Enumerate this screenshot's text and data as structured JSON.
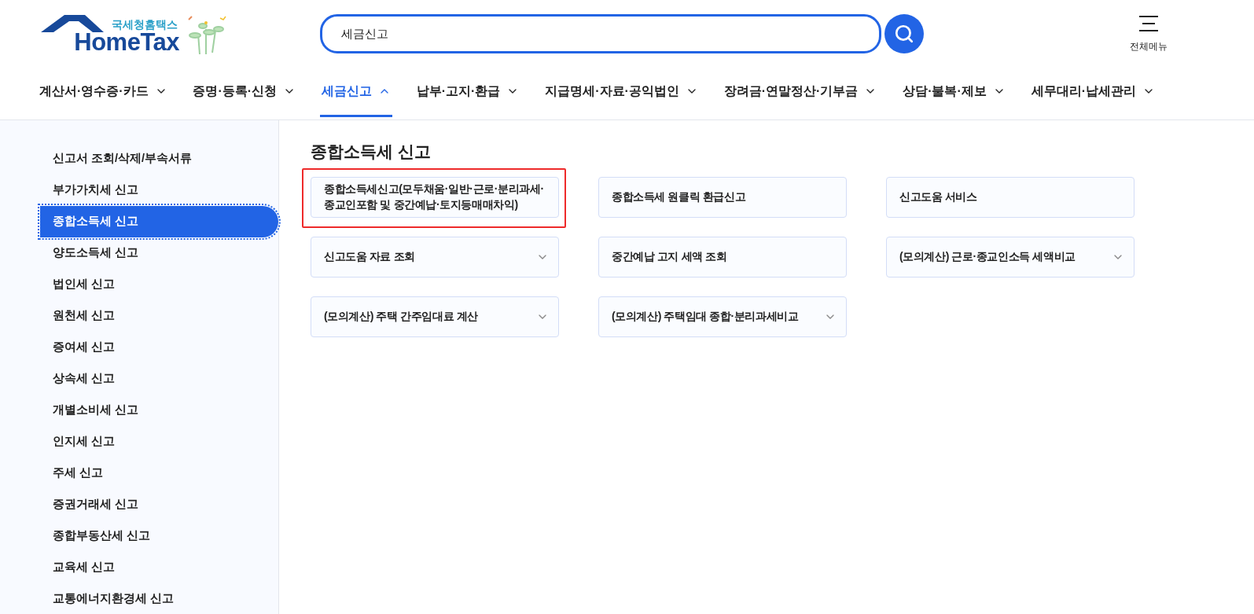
{
  "logo": {
    "caption": "국세청홈택스",
    "wordmark": "HomeTax"
  },
  "search": {
    "value": "세금신고"
  },
  "all_menu": {
    "label": "전체메뉴"
  },
  "nav": [
    {
      "label": "계산서·영수증·카드",
      "selected": false
    },
    {
      "label": "증명·등록·신청",
      "selected": false
    },
    {
      "label": "세금신고",
      "selected": true
    },
    {
      "label": "납부·고지·환급",
      "selected": false
    },
    {
      "label": "지급명세·자료·공익법인",
      "selected": false
    },
    {
      "label": "장려금·연말정산·기부금",
      "selected": false
    },
    {
      "label": "상담·불복·제보",
      "selected": false
    },
    {
      "label": "세무대리·납세관리",
      "selected": false
    }
  ],
  "sidebar": {
    "items": [
      {
        "label": "신고서 조회/삭제/부속서류",
        "selected": false
      },
      {
        "label": "부가가치세 신고",
        "selected": false
      },
      {
        "label": "종합소득세 신고",
        "selected": true
      },
      {
        "label": "양도소득세 신고",
        "selected": false
      },
      {
        "label": "법인세 신고",
        "selected": false
      },
      {
        "label": "원천세 신고",
        "selected": false
      },
      {
        "label": "증여세 신고",
        "selected": false
      },
      {
        "label": "상속세 신고",
        "selected": false
      },
      {
        "label": "개별소비세 신고",
        "selected": false
      },
      {
        "label": "인지세 신고",
        "selected": false
      },
      {
        "label": "주세 신고",
        "selected": false
      },
      {
        "label": "증권거래세 신고",
        "selected": false
      },
      {
        "label": "종합부동산세 신고",
        "selected": false
      },
      {
        "label": "교육세 신고",
        "selected": false
      },
      {
        "label": "교통에너지환경세 신고",
        "selected": false
      }
    ]
  },
  "content": {
    "title": "종합소득세 신고",
    "cards": [
      {
        "label": "종합소득세신고(모두채움·일반·근로·분리과세·종교인포함 및 중간예납·토지등매매차익)",
        "expandable": false,
        "highlighted": true
      },
      {
        "label": "종합소득세 원클릭 환급신고",
        "expandable": false,
        "highlighted": false
      },
      {
        "label": "신고도움 서비스",
        "expandable": false,
        "highlighted": false
      },
      {
        "label": "신고도움 자료 조회",
        "expandable": true,
        "highlighted": false
      },
      {
        "label": "중간예납 고지 세액 조회",
        "expandable": false,
        "highlighted": false
      },
      {
        "label": "(모의계산) 근로·종교인소득 세액비교",
        "expandable": true,
        "highlighted": false
      },
      {
        "label": "(모의계산) 주택 간주임대료 계산",
        "expandable": true,
        "highlighted": false
      },
      {
        "label": "(모의계산) 주택임대 종합·분리과세비교",
        "expandable": true,
        "highlighted": false
      }
    ]
  }
}
